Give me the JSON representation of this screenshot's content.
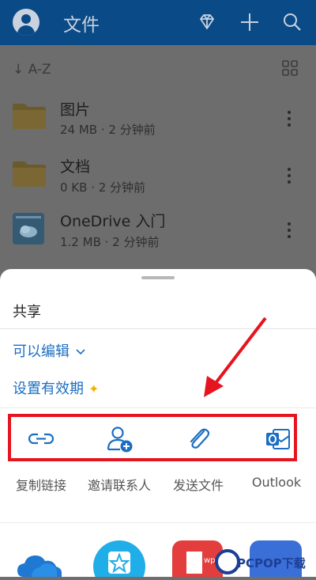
{
  "appbar": {
    "title": "文件",
    "icons": [
      "avatar",
      "premium-diamond-icon",
      "add-icon",
      "search-icon"
    ]
  },
  "sort": {
    "label": "↓ A-Z"
  },
  "files": [
    {
      "name": "图片",
      "meta": "24 MB · 2 分钟前",
      "icon": "folder-icon"
    },
    {
      "name": "文档",
      "meta": "0 KB · 2 分钟前",
      "icon": "folder-icon"
    },
    {
      "name": "OneDrive 入门",
      "meta": "1.2 MB · 2 分钟前",
      "icon": "document-thumbnail"
    }
  ],
  "sheet": {
    "title": "共享",
    "permission": "可以编辑",
    "expiry": "设置有效期",
    "actions": [
      {
        "label": "复制链接",
        "icon": "link-icon"
      },
      {
        "label": "邀请联系人",
        "icon": "add-person-icon"
      },
      {
        "label": "发送文件",
        "icon": "paperclip-icon"
      },
      {
        "label": "Outlook",
        "icon": "outlook-icon"
      }
    ],
    "apps": [
      "onedrive-icon",
      "star-app-icon",
      "wps-icon",
      "blue-app-icon"
    ]
  },
  "watermark": {
    "text": "PCPOP下载"
  },
  "colors": {
    "accent": "#1b6ec2",
    "highlight": "#e6141e",
    "appbar": "#0a4a86"
  }
}
